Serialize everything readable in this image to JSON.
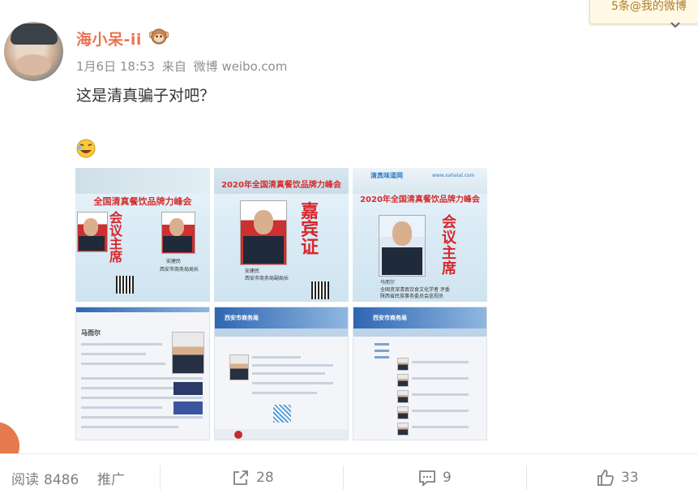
{
  "tooltip": {
    "text": "5条@我的微博"
  },
  "post": {
    "author": "海小呆-ii",
    "time": "1月6日 18:53",
    "source_prefix": "来自",
    "source": "微博 weibo.com",
    "text": "这是清真骗子对吧？"
  },
  "images": {
    "img1": {
      "title": "全国清真餐饮品牌力峰会",
      "vertical": "会议主席",
      "name": "安建民",
      "title2": "西安市商务局局长"
    },
    "img2": {
      "title": "2020年全国清真餐饮品牌力峰会",
      "vertical": "嘉宾证",
      "name": "安建民",
      "role": "西安市商务局副局长"
    },
    "img3": {
      "logo": "清真味道网",
      "url": "www.xahalal.com",
      "title": "2020年全国清真餐饮品牌力峰会",
      "vertical": "会议主席",
      "name": "马而尔",
      "role": "全国资深清真饮食文化学者 评委",
      "role2": "陕西省民族事务委员会巡视员"
    },
    "img4": {
      "heading": "马而尔"
    },
    "img5": {
      "site": "西安市商务局"
    },
    "img6": {
      "site": "西安市商务局"
    }
  },
  "actions": {
    "read_label": "阅读",
    "read_count": "8486",
    "promote": "推广",
    "share_count": "28",
    "comment_count": "9",
    "like_count": "33"
  },
  "colors": {
    "username": "#eb7350",
    "gray": "#808080"
  }
}
